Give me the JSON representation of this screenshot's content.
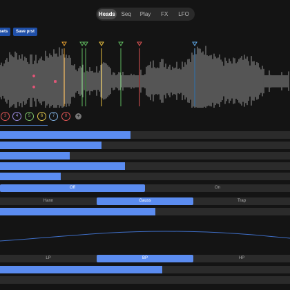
{
  "tabs": [
    {
      "label": "Heads",
      "active": true
    },
    {
      "label": "Seq",
      "active": false
    },
    {
      "label": "Play",
      "active": false
    },
    {
      "label": "FX",
      "active": false
    },
    {
      "label": "LFO",
      "active": false
    }
  ],
  "presets": {
    "presets_label": "esets",
    "save_label": "Save prst"
  },
  "heads": [
    {
      "label": "3",
      "color": "#e05555"
    },
    {
      "label": "4",
      "color": "#9b8ce0"
    },
    {
      "label": "5",
      "color": "#7fc46a"
    },
    {
      "label": "6",
      "color": "#e3c84b"
    },
    {
      "label": "7",
      "color": "#7fb0e0"
    },
    {
      "label": "8",
      "color": "#e05555"
    }
  ],
  "add_head_label": "+",
  "markers": [
    {
      "color": "#e8a030"
    },
    {
      "color": "#5fb85f"
    },
    {
      "color": "#5fb85f"
    },
    {
      "color": "#e8c040"
    },
    {
      "color": "#5fb85f"
    },
    {
      "color": "#e05555"
    },
    {
      "color": "#5fa8e8"
    }
  ],
  "sliders": [
    {
      "level": 0.45
    },
    {
      "level": 0.35
    },
    {
      "level": 0.24
    },
    {
      "level": 0.43
    },
    {
      "level": 0.21
    }
  ],
  "toggle": {
    "options": [
      "Off",
      "On"
    ],
    "selected": 0
  },
  "window_shape": {
    "options": [
      "Hann",
      "Gauss",
      "Trap"
    ],
    "selected": 1
  },
  "window_slider": {
    "level": 0.535
  },
  "filter_type": {
    "options": [
      "LP",
      "BP",
      "HP"
    ],
    "selected": 1
  },
  "filter_slider": {
    "level": 0.56
  },
  "colors": {
    "accent": "#5b8cf0",
    "waveform": "#8a8a8a",
    "background": "#141414"
  }
}
